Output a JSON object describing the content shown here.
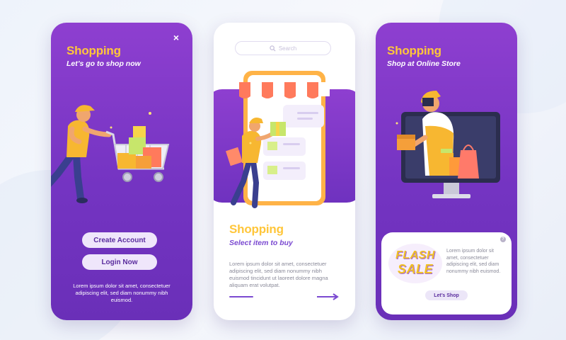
{
  "colors": {
    "primary_purple": "#7e38c8",
    "accent_yellow": "#ffc63a",
    "button_bg": "#efe6fb",
    "button_text": "#5a2c9e"
  },
  "screen1": {
    "title": "Shopping",
    "subtitle": "Let’s go to shop now",
    "close_icon": "×",
    "create_account": "Create Account",
    "login": "Login Now",
    "body": "Lorem ipsum dolor sit amet, consectetuer adipiscing elit, sed diam nonummy nibh euismod."
  },
  "screen2": {
    "search_placeholder": "Search",
    "title": "Shopping",
    "subtitle": "Select item to buy",
    "body": "Lorem ipsum dolor sit amet, consectetuer adipiscing elit, sed diam nonummy nibh euismod tincidunt ut laoreet dolore magna aliquam erat volutpat."
  },
  "screen3": {
    "title": "Shopping",
    "subtitle": "Shop at Online Store",
    "flash_word": "FLASH",
    "sale_word": "SALE",
    "body": "Lorem ipsum dolor sit amet, consectetuer adipiscing elit, sed diam nonummy nibh euismod.",
    "shop_button": "Let’s Shop",
    "help_icon": "?"
  }
}
